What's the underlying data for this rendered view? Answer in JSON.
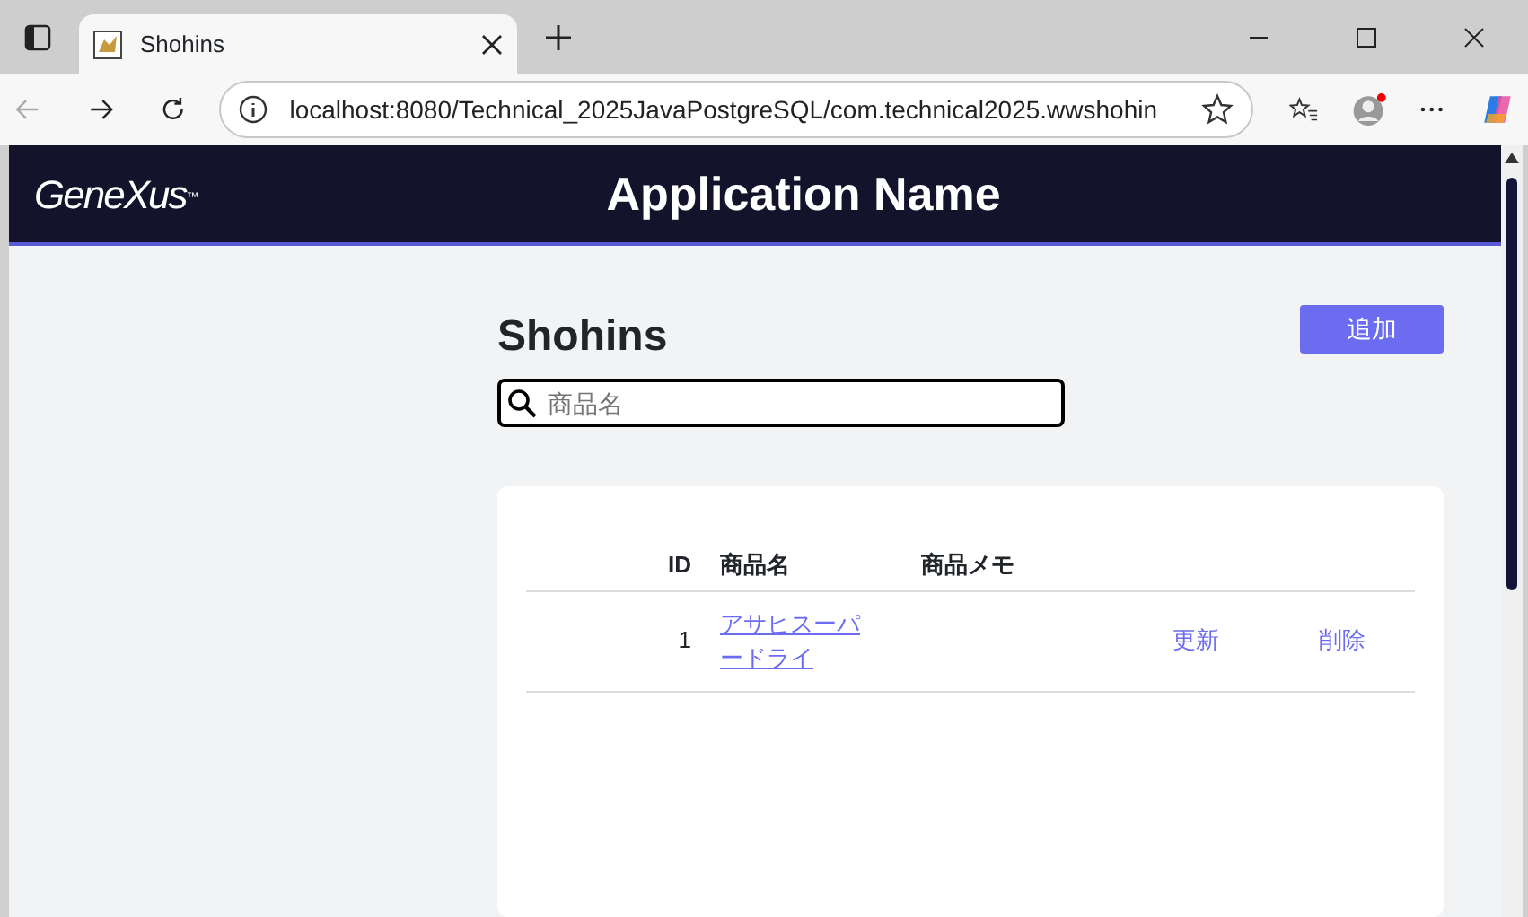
{
  "browser": {
    "tab_title": "Shohins",
    "url": "localhost:8080/Technical_2025JavaPostgreSQL/com.technical2025.wwshohin"
  },
  "header": {
    "logo": "GeneXus",
    "logo_mark": "™",
    "app_name": "Application Name"
  },
  "page": {
    "title": "Shohins",
    "add_button": "追加",
    "search": {
      "placeholder": "商品名"
    }
  },
  "table": {
    "columns": [
      {
        "label": "ID"
      },
      {
        "label": "商品名"
      },
      {
        "label": "商品メモ"
      }
    ],
    "rows": [
      {
        "id": "1",
        "name": "アサヒスーパードライ",
        "update": "更新",
        "delete": "削除"
      }
    ]
  }
}
